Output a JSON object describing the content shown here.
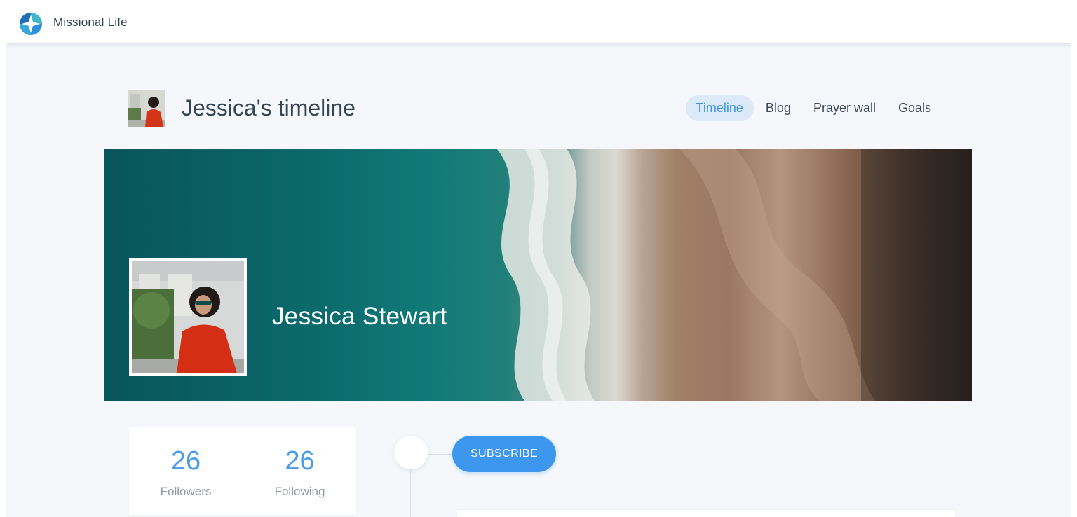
{
  "app": {
    "name": "Missional Life",
    "logo_icon": "compass-star-icon",
    "accent_color": "#3d97ee"
  },
  "profile": {
    "page_title": "Jessica's timeline",
    "display_name": "Jessica Stewart",
    "tabs": [
      {
        "label": "Timeline",
        "active": true
      },
      {
        "label": "Blog",
        "active": false
      },
      {
        "label": "Prayer wall",
        "active": false
      },
      {
        "label": "Goals",
        "active": false
      }
    ]
  },
  "stats": [
    {
      "value": "26",
      "label": "Followers"
    },
    {
      "value": "26",
      "label": "Following"
    }
  ],
  "actions": {
    "subscribe_label": "SUBSCRIBE"
  }
}
